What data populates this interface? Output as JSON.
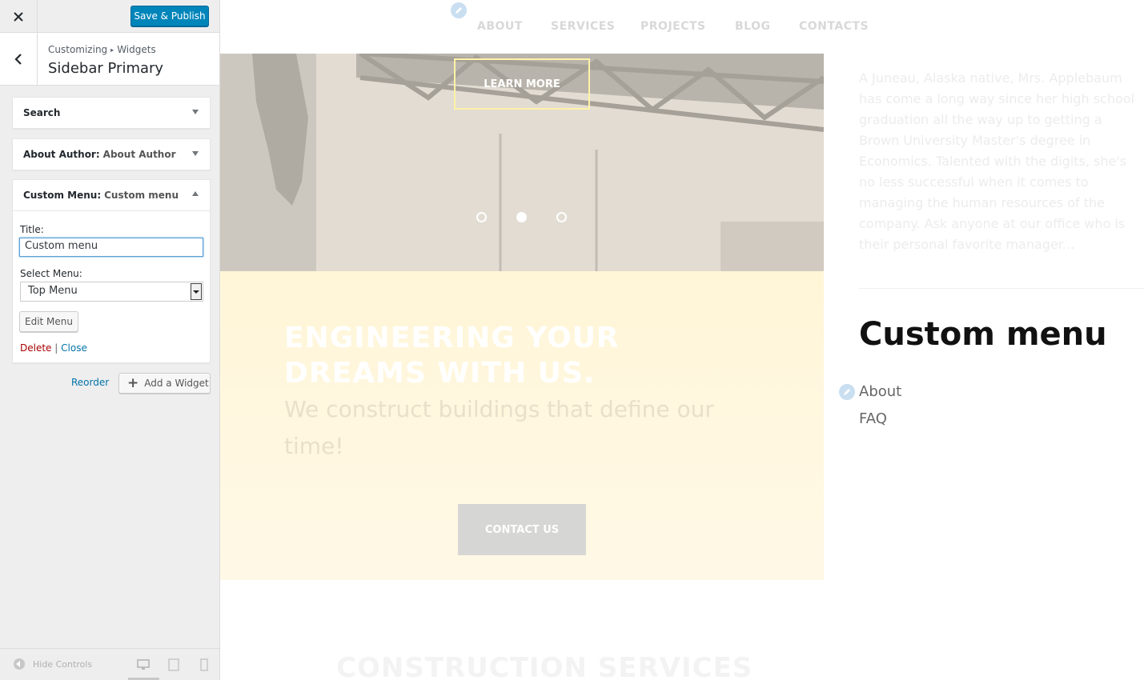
{
  "customizer": {
    "save_label": "Save & Publish",
    "breadcrumb": {
      "root": "Customizing",
      "current": "Widgets"
    },
    "section_title": "Sidebar Primary",
    "widgets": [
      {
        "name": "Search",
        "instance": ""
      },
      {
        "name": "About Author:",
        "instance": "About Author"
      },
      {
        "name": "Custom Menu:",
        "instance": "Custom menu"
      }
    ],
    "form": {
      "title_label": "Title:",
      "title_value": "Custom menu",
      "select_label": "Select Menu:",
      "select_value": "Top Menu",
      "edit_menu": "Edit Menu",
      "delete": "Delete",
      "separator": "|",
      "close": "Close"
    },
    "reorder": "Reorder",
    "add_widget": "Add a Widget",
    "hide_controls": "Hide Controls",
    "accent_color": "#0085ba"
  },
  "preview": {
    "nav": [
      "ABOUT",
      "SERVICES",
      "PROJECTS",
      "BLOG",
      "CONTACTS"
    ],
    "hero": {
      "button": "LEARN MORE",
      "slides": 3,
      "active_slide": 2
    },
    "banner": {
      "headline": "ENGINEERING YOUR DREAMS WITH US.",
      "subline": "We construct buildings that define our time!",
      "button": "CONTACT US"
    },
    "sidebar": {
      "bio": "A Juneau, Alaska native, Mrs. Applebaum has come a long way since her high school graduation all the way up to getting a Brown University Master's degree in Economics. Talented with the digits, she's no less successful when it comes to managing the human resources of the company. Ask anyone at our office who is their personal favorite manager...",
      "menu_title": "Custom menu",
      "menu_items": [
        "About",
        "FAQ"
      ]
    },
    "services_heading": "CONSTRUCTION SERVICES"
  }
}
